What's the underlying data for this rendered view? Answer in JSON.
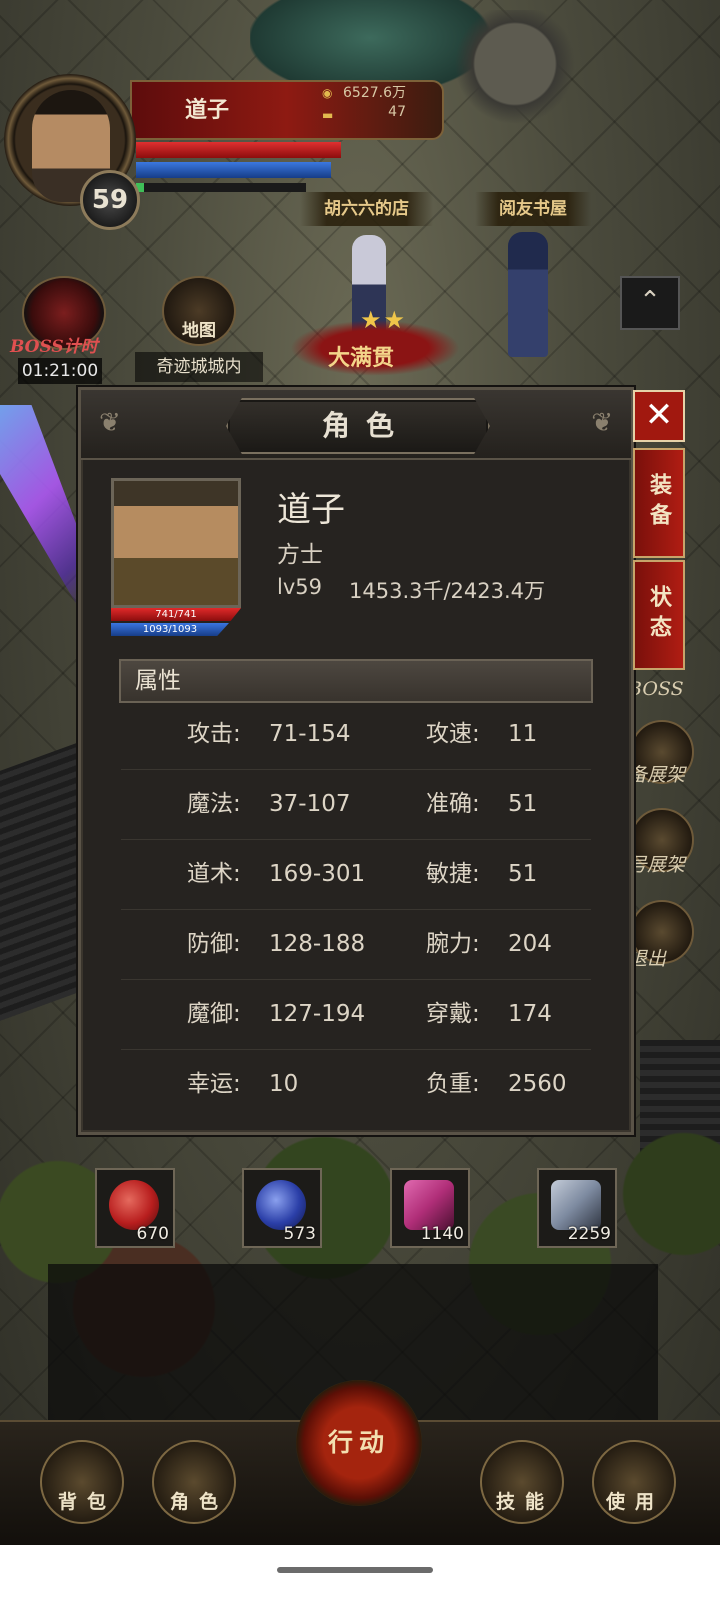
{
  "player": {
    "name": "道子",
    "level": "59",
    "gold": "6527.6万",
    "ingots": "47"
  },
  "shops": [
    "胡六六的店",
    "阅友书屋"
  ],
  "hud": {
    "boss_label": "BOSS计时",
    "boss_timer": "01:21:00",
    "map_label": "地图",
    "location": "奇迹城城内",
    "vip_text": "大满贯",
    "vip_stars": "★★",
    "expand_icon": "chevron-up-icon",
    "right_labels": [
      "BOSS",
      "备展架",
      "号展架",
      "退出"
    ]
  },
  "panel": {
    "title": "角色",
    "close_icon": "close-icon",
    "tabs": [
      "装备",
      "状态"
    ],
    "character": {
      "name": "道子",
      "class": "方士",
      "level": "lv59",
      "exp": "1453.3千/2423.4万",
      "hp": "741/741",
      "mp": "1093/1093"
    },
    "section_title": "属性",
    "stats": [
      {
        "label_l": "攻击:",
        "value_l": "71-154",
        "label_r": "攻速:",
        "value_r": "11"
      },
      {
        "label_l": "魔法:",
        "value_l": "37-107",
        "label_r": "准确:",
        "value_r": "51"
      },
      {
        "label_l": "道术:",
        "value_l": "169-301",
        "label_r": "敏捷:",
        "value_r": "51"
      },
      {
        "label_l": "防御:",
        "value_l": "128-188",
        "label_r": "腕力:",
        "value_r": "204"
      },
      {
        "label_l": "魔御:",
        "value_l": "127-194",
        "label_r": "穿戴:",
        "value_r": "174"
      },
      {
        "label_l": "幸运:",
        "value_l": "10",
        "label_r": "负重:",
        "value_r": "2560"
      }
    ]
  },
  "quick_slots": [
    {
      "item": "red-potion-icon",
      "count": "670",
      "color": "#b81e1e"
    },
    {
      "item": "blue-potion-icon",
      "count": "573",
      "color": "#2b3fa8"
    },
    {
      "item": "scroll-bundle-icon",
      "count": "1140",
      "color": "#b02e78"
    },
    {
      "item": "teleport-scroll-icon",
      "count": "2259",
      "color": "#7d8aa0"
    }
  ],
  "bottom_bar": {
    "bag": "背包",
    "character": "角色",
    "action": "行动",
    "skills": "技能",
    "use": "使用"
  },
  "colors": {
    "panel_bg": "#262320",
    "accent_red": "#a1180f",
    "text": "#ddd5c6"
  }
}
